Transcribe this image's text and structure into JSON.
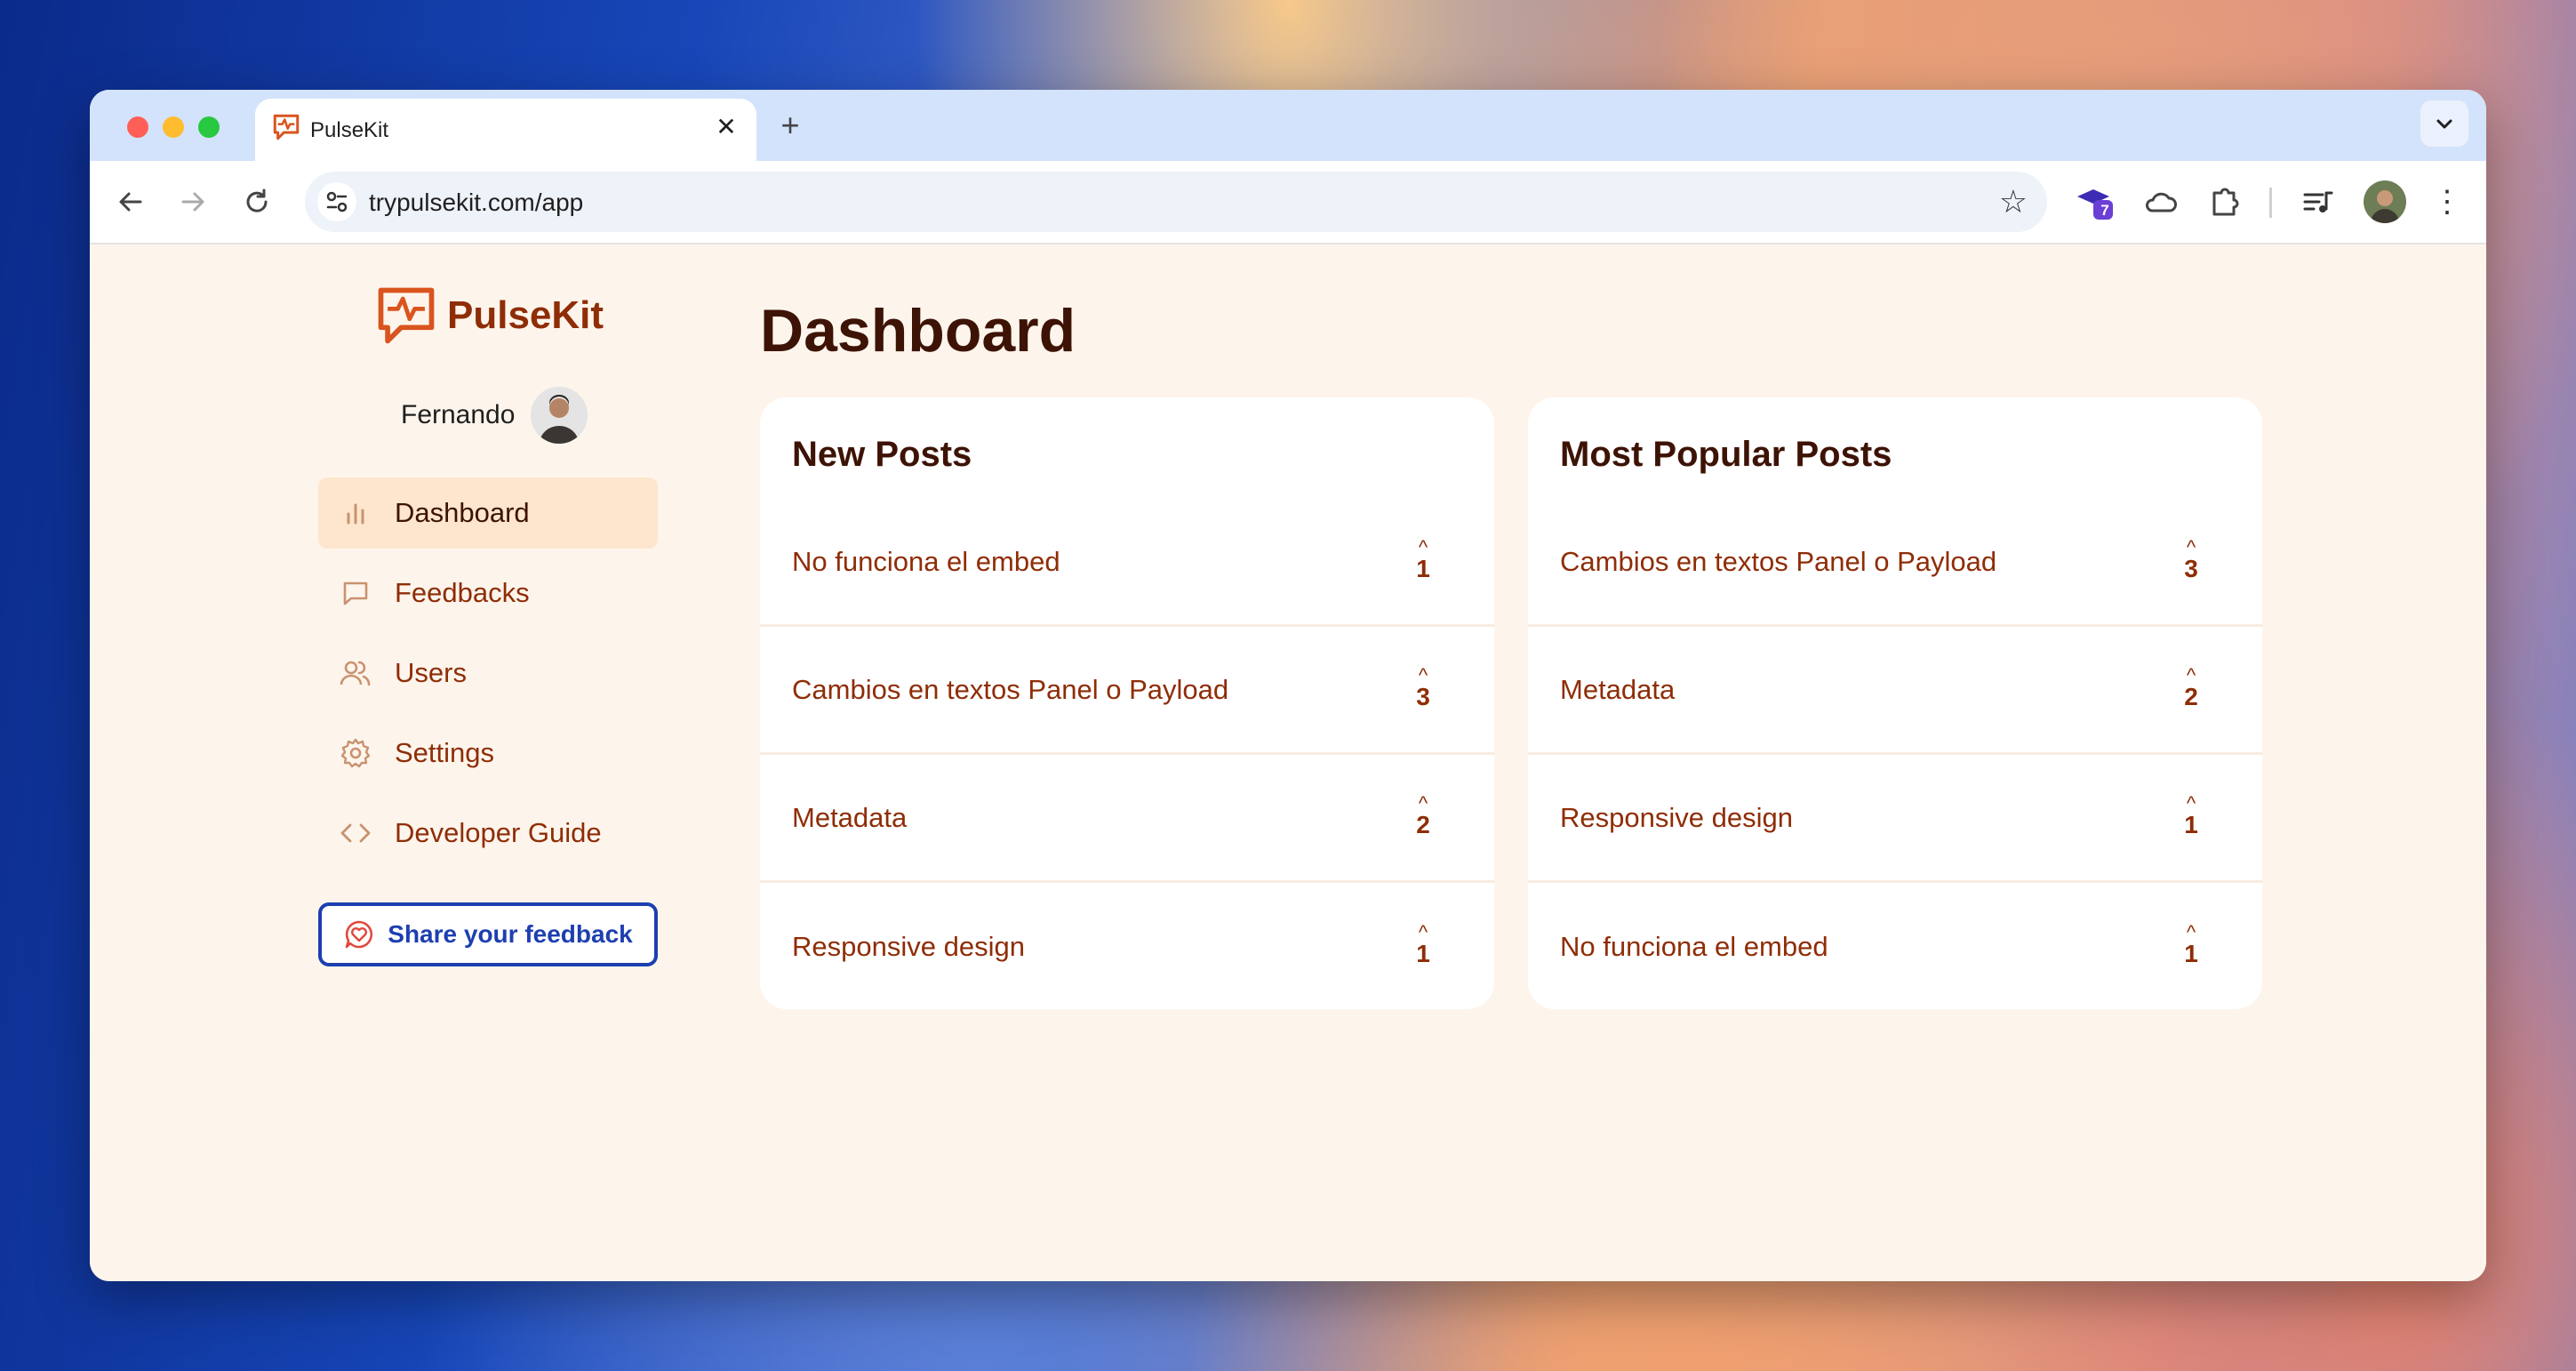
{
  "browser": {
    "tab_title": "PulseKit",
    "url": "trypulsekit.com/app",
    "extension_badge": "7"
  },
  "app": {
    "brand": "PulseKit",
    "user_name": "Fernando",
    "nav": [
      {
        "label": "Dashboard",
        "icon": "bar-chart-icon",
        "active": true
      },
      {
        "label": "Feedbacks",
        "icon": "message-square-icon",
        "active": false
      },
      {
        "label": "Users",
        "icon": "users-icon",
        "active": false
      },
      {
        "label": "Settings",
        "icon": "gear-icon",
        "active": false
      },
      {
        "label": "Developer Guide",
        "icon": "code-icon",
        "active": false
      }
    ],
    "share_button": "Share your feedback"
  },
  "dashboard": {
    "title": "Dashboard",
    "new_posts": {
      "title": "New Posts",
      "items": [
        {
          "title": "No funciona el embed",
          "votes": "1"
        },
        {
          "title": "Cambios en textos Panel o Payload",
          "votes": "3"
        },
        {
          "title": "Metadata",
          "votes": "2"
        },
        {
          "title": "Responsive design",
          "votes": "1"
        }
      ]
    },
    "popular_posts": {
      "title": "Most Popular Posts",
      "items": [
        {
          "title": "Cambios en textos Panel o Payload",
          "votes": "3"
        },
        {
          "title": "Metadata",
          "votes": "2"
        },
        {
          "title": "Responsive design",
          "votes": "1"
        },
        {
          "title": "No funciona el embed",
          "votes": "1"
        }
      ]
    }
  },
  "colors": {
    "brand": "#8f2d06",
    "heading": "#3d1305",
    "page_bg": "#fdf5ec",
    "active_nav_bg": "#fde6cd",
    "share_border": "#1d3fb0"
  }
}
